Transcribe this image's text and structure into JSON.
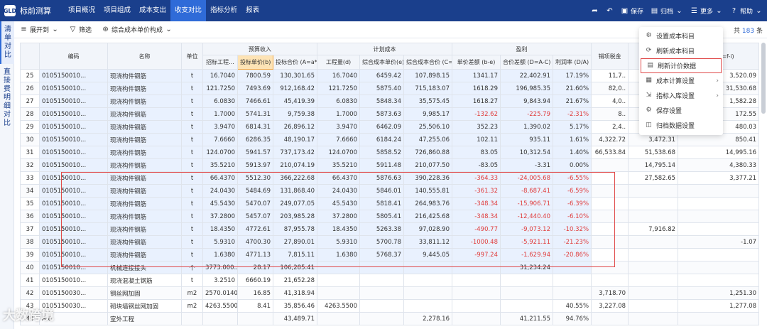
{
  "app": {
    "title": "标前测算",
    "logo_text": "GLD"
  },
  "top_tabs": [
    {
      "label": "项目概况",
      "active": false
    },
    {
      "label": "项目组成",
      "active": false
    },
    {
      "label": "成本支出",
      "active": false
    },
    {
      "label": "收支对比",
      "active": true
    },
    {
      "label": "指标分析",
      "active": false
    },
    {
      "label": "报表",
      "active": false
    }
  ],
  "top_right": {
    "save": "保存",
    "archive": "归档",
    "more": "更多",
    "help": "帮助"
  },
  "left_tabs": [
    {
      "label": "清单对比",
      "active": true
    },
    {
      "label": "直接费明细对比",
      "active": false
    }
  ],
  "toolbar": {
    "expand": "展开到",
    "filter": "筛选",
    "composite": "综合成本单价构成"
  },
  "count": {
    "prefix": "共",
    "value": "183",
    "suffix": "条"
  },
  "headers": {
    "code": "编码",
    "name": "名称",
    "unit": "单位",
    "g_income": "预算收入",
    "g_plan": "计划成本",
    "g_profit": "盈利",
    "bid_qty": "招标工程...",
    "bid_price": "投标单价(b)",
    "bid_total": "投标合价 (A=a*b)",
    "qty": "工程量(d)",
    "cost_price": "综合成本单价(e)",
    "cost_total": "综合成本合价 (C=d*e)",
    "price_diff": "单价差额 (b-e)",
    "total_diff": "合价差额 (D=A-C)",
    "profit_rate": "利润率 (D/A)",
    "tax": "销项税金",
    "col_j": "",
    "col_k": "进销...(=f-i)"
  },
  "menu": [
    {
      "icon": "settings-icon",
      "label": "设置成本科目",
      "arrow": false
    },
    {
      "icon": "refresh-icon",
      "label": "刷新成本科目",
      "arrow": false
    },
    {
      "icon": "document-icon",
      "label": "刷新计价数据",
      "arrow": false,
      "boxed": true
    },
    {
      "icon": "calc-icon",
      "label": "成本计算设置",
      "arrow": true
    },
    {
      "icon": "export-icon",
      "label": "指标入库设置",
      "arrow": true
    },
    {
      "icon": "gear-icon",
      "label": "保存设置",
      "arrow": false
    },
    {
      "icon": "archive-icon",
      "label": "归档数据设置",
      "arrow": false
    }
  ],
  "rows": [
    {
      "no": "25",
      "code": "0105150010...",
      "name": "现浇构件钢筋",
      "unit": "t",
      "bq": "16.7040",
      "bp": "7800.59",
      "bt": "130,301.65",
      "q": "16.7040",
      "cp": "6459.42",
      "ct": "107,898.15",
      "pd": "1341.17",
      "td": "22,402.91",
      "pr": "17.19%",
      "tax": "11,7..",
      "j": "",
      "k": "3,520.09",
      "neg": false
    },
    {
      "no": "26",
      "code": "0105150010...",
      "name": "现浇构件钢筋",
      "unit": "t",
      "bq": "121.7250",
      "bp": "7493.69",
      "bt": "912,168.42",
      "q": "121.7250",
      "cp": "5875.40",
      "ct": "715,183.07",
      "pd": "1618.29",
      "td": "196,985.35",
      "pr": "21.60%",
      "tax": "82,0..",
      "j": "",
      "k": "31,530.68",
      "neg": false
    },
    {
      "no": "27",
      "code": "0105150010...",
      "name": "现浇构件钢筋",
      "unit": "t",
      "bq": "6.0830",
      "bp": "7466.61",
      "bt": "45,419.39",
      "q": "6.0830",
      "cp": "5848.34",
      "ct": "35,575.45",
      "pd": "1618.27",
      "td": "9,843.94",
      "pr": "21.67%",
      "tax": "4,0..",
      "j": "",
      "k": "1,582.28",
      "neg": false
    },
    {
      "no": "28",
      "code": "0105150010...",
      "name": "现浇构件钢筋",
      "unit": "t",
      "bq": "1.7000",
      "bp": "5741.31",
      "bt": "9,759.38",
      "q": "1.7000",
      "cp": "5873.63",
      "ct": "9,985.17",
      "pd": "-132.62",
      "td": "-225.79",
      "pr": "-2.31%",
      "tax": "8..",
      "j": "",
      "k": "172.55",
      "neg": true
    },
    {
      "no": "29",
      "code": "0105150010...",
      "name": "现浇构件钢筋",
      "unit": "t",
      "bq": "3.9470",
      "bp": "6814.31",
      "bt": "26,896.12",
      "q": "3.9470",
      "cp": "6462.09",
      "ct": "25,506.10",
      "pd": "352.23",
      "td": "1,390.02",
      "pr": "5.17%",
      "tax": "2,4..",
      "j": "",
      "k": "480.03",
      "neg": false
    },
    {
      "no": "30",
      "code": "0105150010...",
      "name": "现浇构件钢筋",
      "unit": "t",
      "bq": "7.6660",
      "bp": "6286.35",
      "bt": "48,190.17",
      "q": "7.6660",
      "cp": "6184.24",
      "ct": "47,255.06",
      "pd": "102.11",
      "td": "935.11",
      "pr": "1.61%",
      "tax": "4,322.72",
      "j": "3,472.31",
      "k": "850.41",
      "neg": false
    },
    {
      "no": "31",
      "code": "0105150010...",
      "name": "现浇构件钢筋",
      "unit": "t",
      "bq": "124.0700",
      "bp": "5941.57",
      "bt": "737,173.42",
      "q": "124.0700",
      "cp": "5858.52",
      "ct": "726,860.88",
      "pd": "83.05",
      "td": "10,312.54",
      "pr": "1.40%",
      "tax": "66,533.84",
      "j": "51,538.68",
      "k": "14,995.16",
      "neg": false
    },
    {
      "no": "32",
      "code": "0105150010...",
      "name": "现浇构件钢筋",
      "unit": "t",
      "bq": "35.5210",
      "bp": "5913.97",
      "bt": "210,074.19",
      "q": "35.5210",
      "cp": "5911.48",
      "ct": "210,077.50",
      "pd": "-83.05",
      "td": "-3.31",
      "pr": "0.00%",
      "tax": "",
      "j": "14,795.14",
      "k": "4,380.33",
      "neg": false
    },
    {
      "no": "33",
      "code": "0105150010...",
      "name": "现浇构件钢筋",
      "unit": "t",
      "bq": "66.4370",
      "bp": "5512.30",
      "bt": "366,222.68",
      "q": "66.4370",
      "cp": "5876.63",
      "ct": "390,228.36",
      "pd": "-364.33",
      "td": "-24,005.68",
      "pr": "-6.55%",
      "tax": "",
      "j": "27,582.65",
      "k": "3,377.21",
      "neg": true
    },
    {
      "no": "34",
      "code": "0105150010...",
      "name": "现浇构件钢筋",
      "unit": "t",
      "bq": "24.0430",
      "bp": "5484.69",
      "bt": "131,868.40",
      "q": "24.0430",
      "cp": "5846.01",
      "ct": "140,555.81",
      "pd": "-361.32",
      "td": "-8,687.41",
      "pr": "-6.59%",
      "tax": "",
      "j": "",
      "k": "",
      "neg": true
    },
    {
      "no": "35",
      "code": "0105150010...",
      "name": "现浇构件钢筋",
      "unit": "t",
      "bq": "45.5430",
      "bp": "5470.07",
      "bt": "249,077.05",
      "q": "45.5430",
      "cp": "5818.41",
      "ct": "264,983.76",
      "pd": "-348.34",
      "td": "-15,906.71",
      "pr": "-6.39%",
      "tax": "",
      "j": "",
      "k": "",
      "neg": true
    },
    {
      "no": "36",
      "code": "0105150010...",
      "name": "现浇构件钢筋",
      "unit": "t",
      "bq": "37.2800",
      "bp": "5457.07",
      "bt": "203,985.28",
      "q": "37.2800",
      "cp": "5805.41",
      "ct": "216,425.68",
      "pd": "-348.34",
      "td": "-12,440.40",
      "pr": "-6.10%",
      "tax": "",
      "j": "",
      "k": "",
      "neg": true
    },
    {
      "no": "37",
      "code": "0105150010...",
      "name": "现浇构件钢筋",
      "unit": "t",
      "bq": "18.4350",
      "bp": "4772.61",
      "bt": "87,955.78",
      "q": "18.4350",
      "cp": "5263.38",
      "ct": "97,028.90",
      "pd": "-490.77",
      "td": "-9,073.12",
      "pr": "-10.32%",
      "tax": "",
      "j": "7,916.82",
      "k": "",
      "neg": true
    },
    {
      "no": "38",
      "code": "0105150010...",
      "name": "现浇构件钢筋",
      "unit": "t",
      "bq": "5.9310",
      "bp": "4700.30",
      "bt": "27,890.01",
      "q": "5.9310",
      "cp": "5700.78",
      "ct": "33,811.12",
      "pd": "-1000.48",
      "td": "-5,921.11",
      "pr": "-21.23%",
      "tax": "",
      "j": "",
      "k": "-1.07",
      "neg": true
    },
    {
      "no": "39",
      "code": "0105150010...",
      "name": "现浇构件钢筋",
      "unit": "t",
      "bq": "1.6380",
      "bp": "4771.13",
      "bt": "7,815.11",
      "q": "1.6380",
      "cp": "5768.37",
      "ct": "9,445.05",
      "pd": "-997.24",
      "td": "-1,629.94",
      "pr": "-20.86%",
      "tax": "",
      "j": "",
      "k": "",
      "neg": true
    },
    {
      "no": "40",
      "code": "0105150010...",
      "name": "机械连接接头",
      "unit": "个",
      "bq": "3773.000...",
      "bp": "28.17",
      "bt": "106,285.41",
      "q": "",
      "cp": "",
      "ct": "",
      "pd": "",
      "td": "31,234.24",
      "pr": "",
      "tax": "",
      "j": "",
      "k": "",
      "neg": false
    },
    {
      "no": "41",
      "code": "0105150010...",
      "name": "现浇混凝土钢筋",
      "unit": "t",
      "bq": "3.2510",
      "bp": "6660.19",
      "bt": "21,652.28",
      "q": "",
      "cp": "",
      "ct": "",
      "pd": "",
      "td": "",
      "pr": "",
      "tax": "",
      "j": "",
      "k": "",
      "neg": false
    },
    {
      "no": "42",
      "code": "0105150030...",
      "name": "钢丝网加固",
      "unit": "m2",
      "bq": "2570.0140",
      "bp": "16.85",
      "bt": "41,318.94",
      "q": "",
      "cp": "",
      "ct": "",
      "pd": "",
      "td": "",
      "pr": "",
      "tax": "3,718.70",
      "j": "",
      "k": "1,251.30",
      "neg": false
    },
    {
      "no": "43",
      "code": "0105150030...",
      "name": "砌块墙钢丝网加固",
      "unit": "m2",
      "bq": "4263.5500",
      "bp": "8.41",
      "bt": "35,856.46",
      "q": "4263.5500",
      "cp": "",
      "ct": "",
      "pd": "",
      "td": "",
      "pr": "40.55%",
      "tax": "3,227.08",
      "j": "",
      "k": "1,277.08",
      "neg": false
    },
    {
      "no": "44",
      "code": "A.6",
      "name": "室外工程",
      "unit": "",
      "bq": "",
      "bp": "",
      "bt": "43,489.71",
      "q": "",
      "cp": "",
      "ct": "2,278.16",
      "pd": "",
      "td": "41,211.55",
      "pr": "94.76%",
      "tax": "",
      "j": "",
      "k": "",
      "neg": false
    }
  ],
  "watermark": "大数跨境"
}
